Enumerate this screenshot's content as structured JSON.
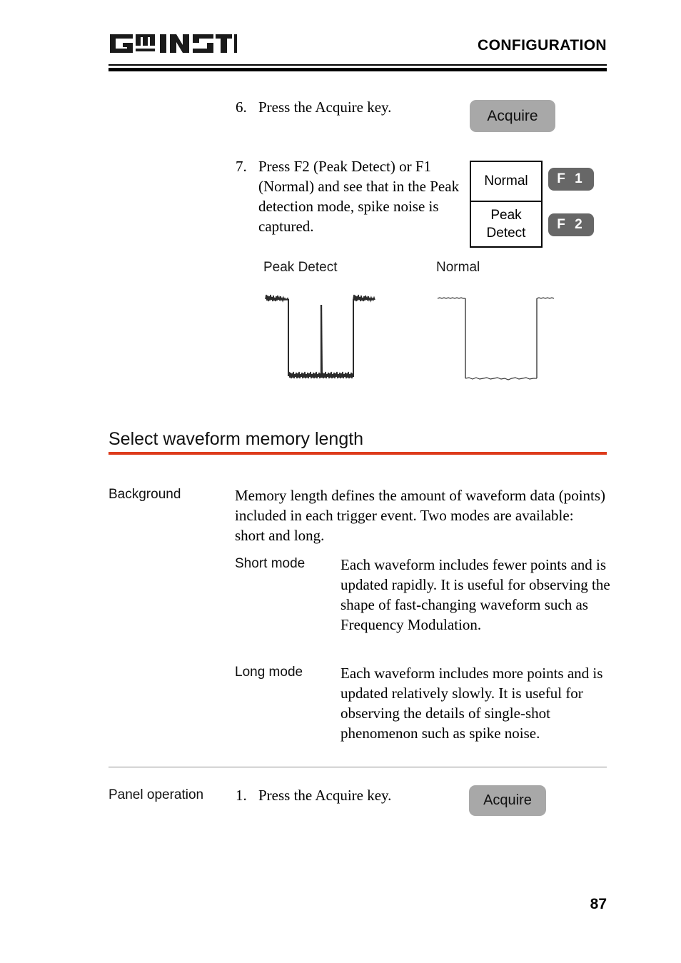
{
  "header": {
    "logo_text": "GW INSTEK",
    "title": "CONFIGURATION"
  },
  "steps": [
    {
      "number": "6.",
      "text": "Press the Acquire key.",
      "key_label": "Acquire"
    },
    {
      "number": "7.",
      "text": "Press F2 (Peak Detect) or F1 (Normal) and see that in the Peak detection mode, spike noise is captured.",
      "softkeys": [
        {
          "label": "Normal",
          "fkey": "F 1"
        },
        {
          "label_line1": "Peak",
          "label_line2": "Detect",
          "fkey": "F 2"
        }
      ]
    }
  ],
  "figures": {
    "peak_detect_label": "Peak Detect",
    "normal_label": "Normal"
  },
  "section": {
    "heading": "Select waveform memory length",
    "accent_color": "#dd3b1c",
    "rows": [
      {
        "label": "Background",
        "body": "Memory length defines the amount of waveform data (points) included in each trigger event. Two modes are available: short and long."
      },
      {
        "label": "Short mode",
        "body": "Each waveform includes fewer points and is updated rapidly. It is useful for observing the shape of fast-changing waveform such as Frequency Modulation."
      },
      {
        "label": "Long mode",
        "body": "Each waveform includes more points and is updated relatively slowly. It is useful for observing the details of single-shot phenomenon such as spike noise."
      }
    ]
  },
  "panel_operation": {
    "label": "Panel operation",
    "step_number": "1.",
    "step_text": "Press the Acquire key.",
    "key_label": "Acquire"
  },
  "footer": {
    "page_number": "87"
  }
}
